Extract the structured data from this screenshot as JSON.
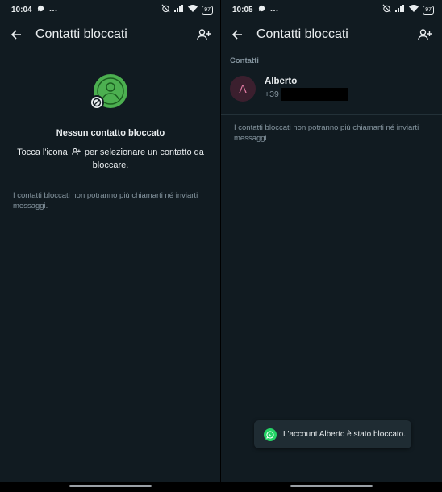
{
  "left_screen": {
    "status": {
      "time": "10:04",
      "battery": "97"
    },
    "appbar": {
      "title": "Contatti bloccati"
    },
    "empty_state": {
      "title": "Nessun contatto bloccato",
      "desc_before": "Tocca l'icona",
      "desc_after": "per selezionare un contatto da bloccare."
    },
    "note": "I contatti bloccati non potranno più chiamarti né inviarti messaggi."
  },
  "right_screen": {
    "status": {
      "time": "10:05",
      "battery": "97"
    },
    "appbar": {
      "title": "Contatti bloccati"
    },
    "section_label": "Contatti",
    "contacts": [
      {
        "initial": "A",
        "name": "Alberto",
        "phone_prefix": "+39"
      }
    ],
    "note": "I contatti bloccati non potranno più chiamarti né inviarti messaggi.",
    "toast": {
      "text": "L'account Alberto è stato bloccato."
    }
  },
  "colors": {
    "background": "#111b21",
    "accent_green": "#25d366",
    "illustration_green": "#4caf50",
    "avatar_bg": "#3b1f2e",
    "avatar_text": "#e57ea6",
    "muted_text": "#8696a0",
    "primary_text": "#e9edef"
  },
  "icons": {
    "back": "arrow-left-icon",
    "add_contact": "person-add-icon",
    "blocked_illustration": "blocked-person-icon",
    "whatsapp": "whatsapp-icon"
  }
}
